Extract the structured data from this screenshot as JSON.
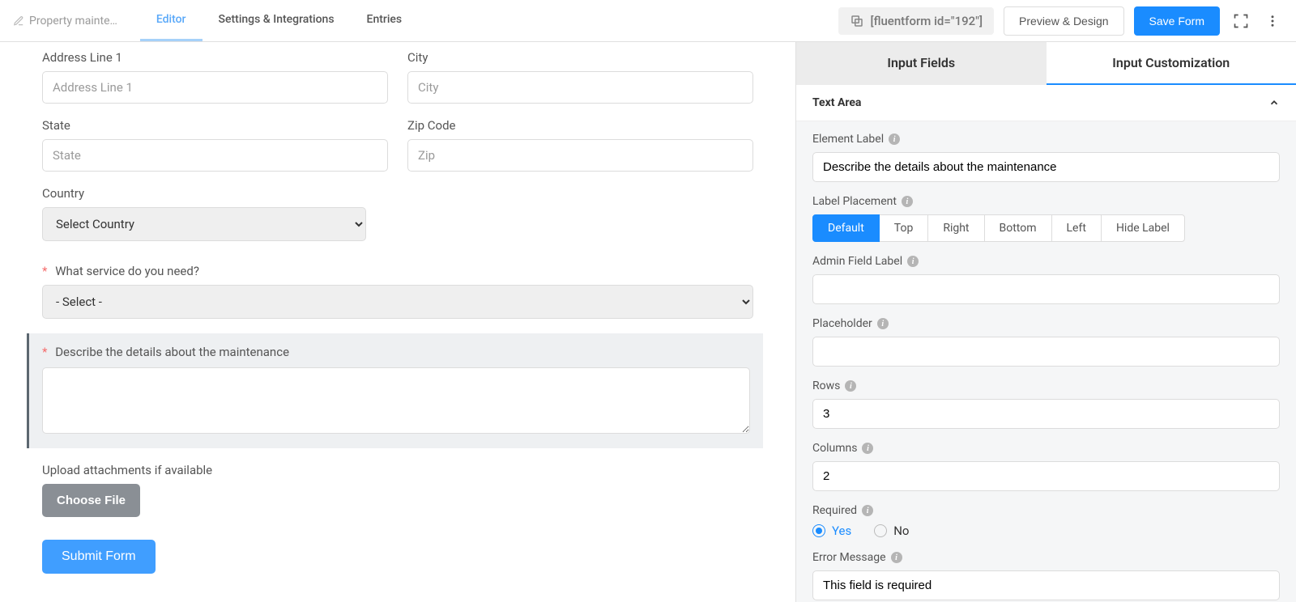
{
  "header": {
    "pageTitle": "Property mainte…",
    "tabs": {
      "editor": "Editor",
      "settings": "Settings & Integrations",
      "entries": "Entries"
    },
    "shortcode": "[fluentform id=\"192\"]",
    "previewBtn": "Preview & Design",
    "saveBtn": "Save Form"
  },
  "form": {
    "address1": {
      "label": "Address Line 1",
      "placeholder": "Address Line 1"
    },
    "city": {
      "label": "City",
      "placeholder": "City"
    },
    "state": {
      "label": "State",
      "placeholder": "State"
    },
    "zip": {
      "label": "Zip Code",
      "placeholder": "Zip"
    },
    "country": {
      "label": "Country",
      "value": "Select Country"
    },
    "service": {
      "label": "What service do you need?",
      "value": "- Select -"
    },
    "describe": {
      "label": "Describe the details about the maintenance"
    },
    "upload": {
      "label": "Upload attachments if available",
      "button": "Choose File"
    },
    "submit": "Submit Form"
  },
  "sidebar": {
    "tabs": {
      "fields": "Input Fields",
      "customization": "Input Customization"
    },
    "panelTitle": "Text Area",
    "settings": {
      "elementLabel": {
        "label": "Element Label",
        "value": "Describe the details about the maintenance"
      },
      "labelPlacement": {
        "label": "Label Placement",
        "options": {
          "default": "Default",
          "top": "Top",
          "right": "Right",
          "bottom": "Bottom",
          "left": "Left",
          "hide": "Hide Label"
        }
      },
      "adminFieldLabel": {
        "label": "Admin Field Label",
        "value": ""
      },
      "placeholder": {
        "label": "Placeholder",
        "value": ""
      },
      "rows": {
        "label": "Rows",
        "value": "3"
      },
      "columns": {
        "label": "Columns",
        "value": "2"
      },
      "required": {
        "label": "Required",
        "yes": "Yes",
        "no": "No"
      },
      "errorMessage": {
        "label": "Error Message",
        "value": "This field is required"
      }
    }
  }
}
